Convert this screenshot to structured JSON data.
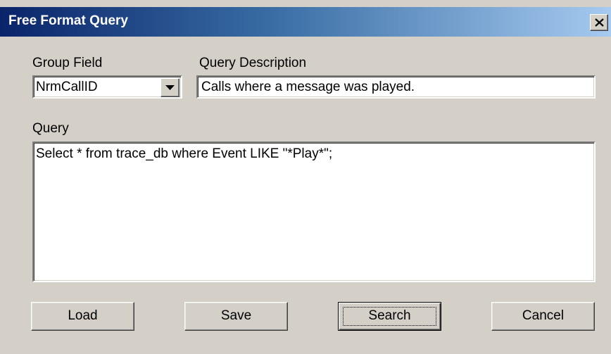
{
  "window": {
    "title": "Free Format Query",
    "close_label": "Close"
  },
  "group_field": {
    "label": "Group Field",
    "value": "NrmCallID"
  },
  "query_description": {
    "label": "Query Description",
    "value": "Calls where a message was played."
  },
  "query": {
    "label": "Query",
    "value": "Select * from trace_db where Event LIKE \"*Play*\";"
  },
  "buttons": {
    "load": "Load",
    "save": "Save",
    "search": "Search",
    "cancel": "Cancel"
  },
  "colors": {
    "titlebar_start": "#0a246a",
    "titlebar_end": "#a6caf0",
    "face": "#d4d0c8"
  }
}
